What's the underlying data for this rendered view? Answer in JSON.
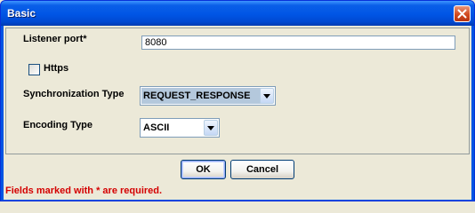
{
  "window": {
    "title": "Basic"
  },
  "form": {
    "listener_port_label": "Listener port*",
    "listener_port_value": "8080",
    "https_label": "Https",
    "https_checked": false,
    "sync_type_label": "Synchronization Type",
    "sync_type_value": "REQUEST_RESPONSE",
    "encoding_type_label": "Encoding Type",
    "encoding_type_value": "ASCII"
  },
  "buttons": {
    "ok_label": "OK",
    "cancel_label": "Cancel"
  },
  "footer": {
    "required_note": "Fields marked with * are required."
  },
  "icons": {
    "close": "close-icon",
    "dropdown": "chevron-down-icon"
  },
  "colors": {
    "titlebar": "#0055e5",
    "close_button": "#d24a1f",
    "required_text": "#d40000",
    "selected_combo": "#b4c8dc"
  }
}
